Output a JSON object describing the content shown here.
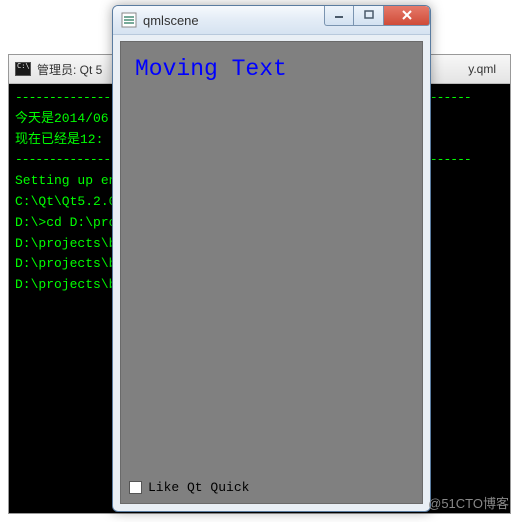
{
  "console": {
    "title_prefix": "管理员: Qt 5",
    "title_suffix": "y.qml",
    "lines": [
      "-------------------------------------------------------------------",
      "今天是2014/06",
      "现在已经是12:",
      "-------------------------------------------------------------------",
      "Setting up en",
      "",
      "C:\\Qt\\Qt5.2.0",
      "",
      "D:\\>cd D:\\pro",
      "",
      "D:\\projects\\b",
      "",
      "D:\\projects\\b",
      "",
      "D:\\projects\\b"
    ]
  },
  "qml": {
    "title": "qmlscene",
    "moving_text": "Moving Text",
    "checkbox_label": "Like Qt Quick"
  },
  "watermark": "@51CTO博客"
}
